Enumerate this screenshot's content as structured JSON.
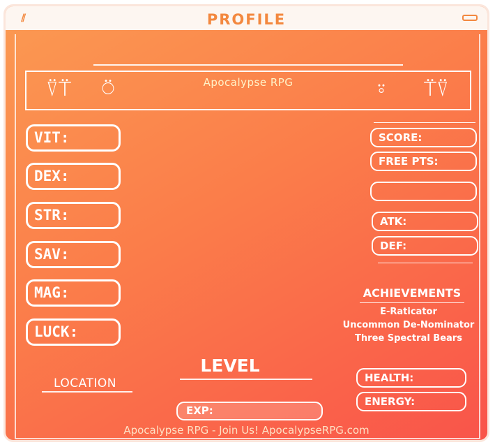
{
  "window": {
    "title": "PROFILE"
  },
  "banner": {
    "text": "Apocalypse RPG",
    "glyphs": [
      "ᛯᛟ",
      "ᛗ",
      "ᛠ",
      "ᛯᛟ"
    ]
  },
  "stats": [
    {
      "label": "VIT:"
    },
    {
      "label": "DEX:"
    },
    {
      "label": "STR:"
    },
    {
      "label": "SAV:"
    },
    {
      "label": "MAG:"
    },
    {
      "label": "LUCK:"
    }
  ],
  "right_panel": {
    "score_label": "SCORE:",
    "free_pts_label": "FREE PTS:",
    "empty_label": "",
    "atk_label": "ATK:",
    "def_label": "DEF:"
  },
  "achievements": {
    "title": "ACHIEVEMENTS",
    "items": [
      "E-Raticator",
      "Uncommon De-Nominator",
      "Three Spectral Bears"
    ]
  },
  "vitals": {
    "health_label": "HEALTH:",
    "energy_label": "ENERGY:"
  },
  "level_label": "LEVEL",
  "location_label": "LOCATION",
  "exp_label": "EXP:",
  "footer": "Apocalypse RPG - Join Us! ApocalypseRPG.com",
  "colors": {
    "gradient_start": "#fb9a52",
    "gradient_end": "#f9544a",
    "title_accent": "#f3883f"
  }
}
